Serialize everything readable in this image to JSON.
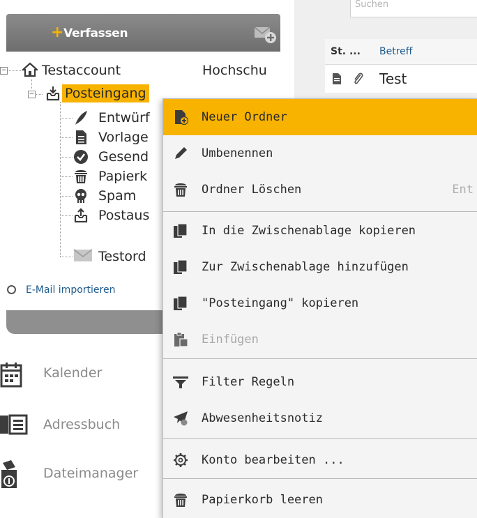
{
  "compose": {
    "label": "Verfassen",
    "plus": "+"
  },
  "tree": {
    "account": "Testaccount",
    "account_extra": "Hochschu",
    "folders": [
      {
        "id": "inbox",
        "label": "Posteingang",
        "icon": "inbox-icon"
      },
      {
        "id": "drafts",
        "label": "Entwürf",
        "icon": "quill-icon"
      },
      {
        "id": "templates",
        "label": "Vorlage",
        "icon": "document-icon"
      },
      {
        "id": "sent",
        "label": "Gesend",
        "icon": "checkmark-circle-icon"
      },
      {
        "id": "trash",
        "label": "Papierk",
        "icon": "trash-icon"
      },
      {
        "id": "spam",
        "label": "Spam",
        "icon": "skull-icon"
      },
      {
        "id": "outbox",
        "label": "Postaus",
        "icon": "outbox-icon"
      },
      {
        "id": "testfolder",
        "label": "Testord",
        "icon": "envelope-icon"
      }
    ]
  },
  "import_link": "E-Mail importieren",
  "nav": [
    {
      "label": "Kalender",
      "icon": "calendar-icon"
    },
    {
      "label": "Adressbuch",
      "icon": "address-card-icon"
    },
    {
      "label": "Dateimanager",
      "icon": "file-manager-icon"
    }
  ],
  "message_list": {
    "search_placeholder": "Suchen",
    "columns": {
      "status": "St. ...",
      "subject": "Betreff"
    },
    "rows": [
      {
        "subject": "Test"
      }
    ]
  },
  "context_menu": {
    "items": [
      {
        "label": "Neuer Ordner",
        "icon": "new-folder-icon",
        "active": true
      },
      {
        "label": "Umbenennen",
        "icon": "pencil-icon"
      },
      {
        "label": "Ordner Löschen",
        "icon": "trash-icon",
        "shortcut": "Ent"
      },
      {
        "label": "In die Zwischenablage kopieren",
        "icon": "clipboard-copy-icon"
      },
      {
        "label": "Zur Zwischenablage hinzufügen",
        "icon": "clipboard-add-icon"
      },
      {
        "label": "\"Posteingang\" kopieren",
        "icon": "copy-folder-icon"
      },
      {
        "label": "Einfügen",
        "icon": "paste-icon",
        "disabled": true
      },
      {
        "label": "Filter Regeln",
        "icon": "filter-icon"
      },
      {
        "label": "Abwesenheitsnotiz",
        "icon": "absence-note-icon"
      },
      {
        "label": "Konto bearbeiten ...",
        "icon": "gear-icon"
      },
      {
        "label": "Papierkorb leeren",
        "icon": "trash-icon"
      }
    ]
  },
  "colors": {
    "accent": "#f8b300",
    "sidebar_bar": "#7d7d7d",
    "link": "#1d5a8e"
  }
}
